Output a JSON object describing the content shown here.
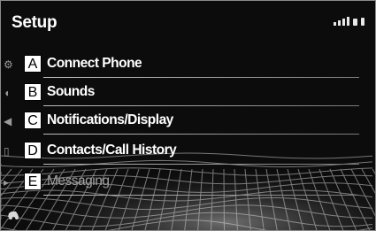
{
  "header": {
    "title": "Setup"
  },
  "menu": [
    {
      "letter": "A",
      "label": "Connect Phone",
      "icon": "gear-icon"
    },
    {
      "letter": "B",
      "label": "Sounds",
      "icon": "speaker-icon"
    },
    {
      "letter": "C",
      "label": "Notifications/Display",
      "icon": "volume-icon"
    },
    {
      "letter": "D",
      "label": "Contacts/Call History",
      "icon": "contacts-icon"
    },
    {
      "letter": "E",
      "label": "Messaging",
      "icon": "message-icon"
    }
  ],
  "status_icons": [
    "signal-icon",
    "phone-icon",
    "battery-icon"
  ],
  "bottom_icon": "car-settings-icon",
  "colors": {
    "background": "#0c0c0c",
    "text": "#ffffff",
    "dim_text": "#a0a0a0",
    "label_box": "#ffffff"
  }
}
